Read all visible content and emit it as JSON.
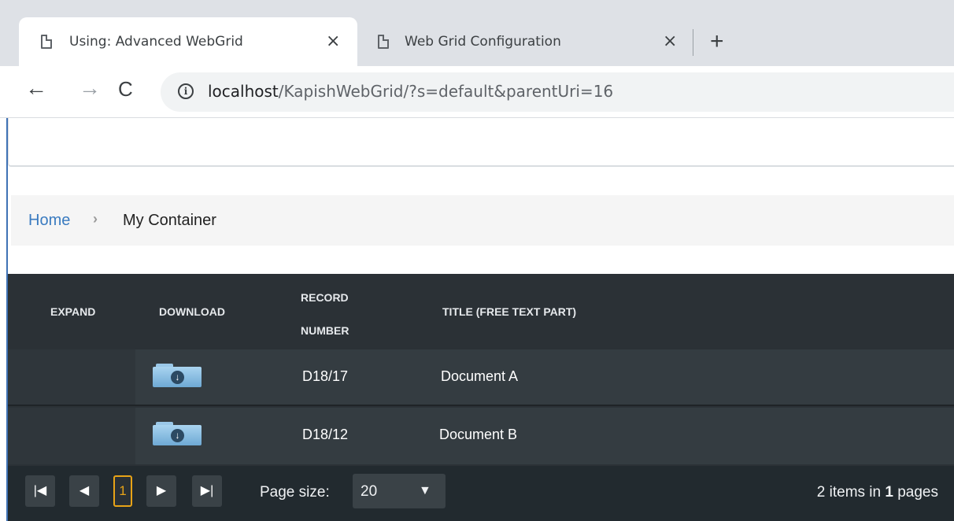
{
  "browser": {
    "tabs": [
      {
        "title": "Using: Advanced WebGrid",
        "close": "×"
      },
      {
        "title": "Web Grid Configuration",
        "close": "×"
      }
    ],
    "new_tab": "+",
    "back": "←",
    "forward": "→",
    "reload": "C",
    "info": "i",
    "url_host": "localhost",
    "url_path": "/KapishWebGrid/?s=default&parentUri=16"
  },
  "breadcrumb": {
    "home": "Home",
    "separator": "›",
    "current": "My Container"
  },
  "grid": {
    "columns": {
      "expand": "EXPAND",
      "download": "DOWNLOAD",
      "record_line1": "RECORD",
      "record_line2": "NUMBER",
      "title": "TITLE (FREE TEXT PART)"
    },
    "rows": [
      {
        "record_number": "D18/17",
        "title": "Document A",
        "download_icon": "folder-download-icon"
      },
      {
        "record_number": "D18/12",
        "title": "Document B",
        "download_icon": "folder-download-icon"
      }
    ],
    "pager": {
      "first": "|◀",
      "prev": "◀",
      "current_page": "1",
      "next": "▶",
      "last": "▶|",
      "page_size_label": "Page size:",
      "page_size_value": "20",
      "page_size_arrow": "▼",
      "info_prefix": "2 items in ",
      "info_pages": "1",
      "info_suffix": " pages"
    }
  },
  "colors": {
    "grid_bg": "#2b3136",
    "row_bg": "#343c41",
    "pager_bg": "#222a2f",
    "page_highlight": "#e8a317",
    "link": "#3a7bc0"
  }
}
